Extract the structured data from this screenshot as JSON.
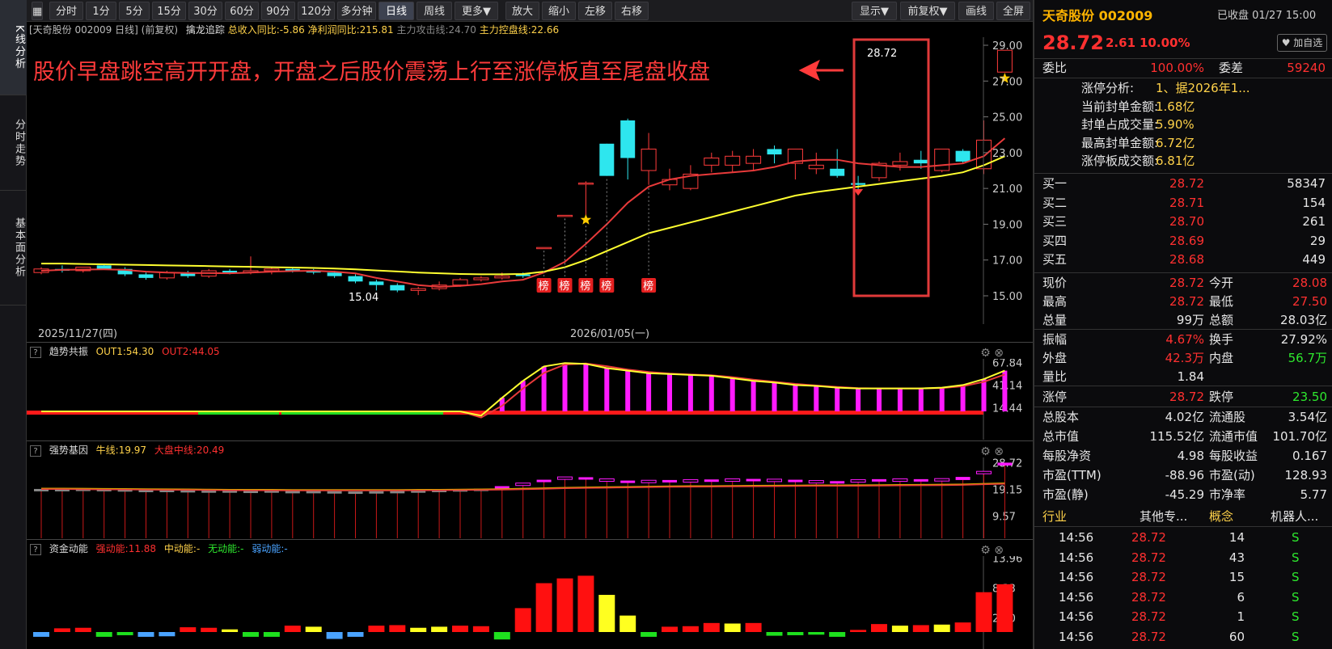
{
  "side_tabs": [
    "K线分析",
    "分时走势",
    "基本面分析"
  ],
  "toolbar": {
    "periods": [
      "分时",
      "1分",
      "5分",
      "15分",
      "30分",
      "60分",
      "90分",
      "120分",
      "多分钟",
      "日线",
      "周线",
      "更多▼"
    ],
    "active_period": "日线",
    "tools": [
      "放大",
      "缩小",
      "左移",
      "右移"
    ],
    "right": [
      "显示▼",
      "前复权▼",
      "画线",
      "全屏"
    ]
  },
  "info_line": {
    "stock": "[天奇股份 002009 日线]",
    "adj": "(前复权)",
    "indicator": "擒龙追踪",
    "revenue_yoy": "总收入同比:-5.86",
    "profit_yoy": "净利润同比:215.81",
    "attack_line": "主力攻击线:24.70",
    "control_line": "主力控盘线:22.66"
  },
  "annotation": "股价早盘跳空高开开盘，开盘之后股价震荡上行至涨停板直至尾盘收盘",
  "main_chart": {
    "price_axis": [
      "29.00",
      "27.00",
      "25.00",
      "23.00",
      "21.00",
      "19.00",
      "17.00",
      "15.00"
    ],
    "last_price_label": "28.72",
    "low_label": "15.04",
    "bang_label": "榜",
    "dates": [
      "2025/11/27(四)",
      "2026/01/05(一)"
    ]
  },
  "panels": {
    "trend": {
      "name": "趋势共振",
      "out1": "OUT1:54.30",
      "out2": "OUT2:44.05",
      "axis": [
        "67.84",
        "41.14",
        "14.44"
      ]
    },
    "gene": {
      "name": "强势基因",
      "bull": "牛线:19.97",
      "mid": "大盘中线:20.49",
      "axis": [
        "28.72",
        "19.15",
        "9.57"
      ]
    },
    "fund": {
      "name": "资金动能",
      "strong": "强动能:11.88",
      "medium": "中动能:-",
      "none": "无动能:-",
      "weak": "弱动能:-",
      "axis": [
        "13.96",
        "8.33",
        "2.70"
      ]
    }
  },
  "chart_data": {
    "type": "bar",
    "title": "天奇股份 002009 日线",
    "ohlc": [
      [
        16.3,
        16.6,
        16.2,
        16.5
      ],
      [
        16.5,
        16.7,
        16.3,
        16.4
      ],
      [
        16.4,
        16.6,
        16.3,
        16.6
      ],
      [
        16.7,
        16.8,
        16.5,
        16.5
      ],
      [
        16.5,
        16.6,
        16.1,
        16.2
      ],
      [
        16.2,
        16.3,
        15.9,
        16.0
      ],
      [
        16.0,
        16.4,
        15.9,
        16.3
      ],
      [
        16.3,
        16.4,
        16.0,
        16.1
      ],
      [
        16.1,
        16.5,
        16.0,
        16.4
      ],
      [
        16.4,
        16.5,
        16.2,
        16.3
      ],
      [
        16.3,
        17.2,
        16.2,
        16.4
      ],
      [
        16.4,
        16.6,
        16.2,
        16.5
      ],
      [
        16.5,
        16.6,
        16.3,
        16.4
      ],
      [
        16.4,
        16.5,
        16.2,
        16.3
      ],
      [
        16.3,
        16.4,
        16.0,
        16.1
      ],
      [
        16.1,
        16.2,
        15.7,
        15.8
      ],
      [
        15.8,
        15.9,
        15.3,
        15.6
      ],
      [
        15.6,
        15.7,
        15.2,
        15.3
      ],
      [
        15.3,
        15.5,
        15.04,
        15.4
      ],
      [
        15.4,
        15.8,
        15.3,
        15.6
      ],
      [
        15.6,
        16.0,
        15.5,
        15.9
      ],
      [
        15.9,
        16.1,
        15.8,
        16.0
      ],
      [
        16.0,
        16.3,
        15.9,
        16.1
      ],
      [
        16.2,
        16.3,
        16.0,
        16.1
      ],
      [
        17.7,
        17.7,
        17.7,
        17.7
      ],
      [
        19.5,
        19.5,
        19.5,
        19.5
      ],
      [
        21.3,
        21.4,
        19.1,
        21.3
      ],
      [
        23.5,
        23.5,
        21.7,
        21.7
      ],
      [
        24.8,
        24.9,
        21.5,
        22.7
      ],
      [
        22.0,
        24.1,
        21.2,
        23.2
      ],
      [
        21.2,
        22.1,
        20.9,
        21.5
      ],
      [
        21.0,
        22.3,
        20.9,
        21.8
      ],
      [
        22.3,
        23.0,
        21.9,
        22.7
      ],
      [
        22.3,
        23.1,
        21.9,
        22.8
      ],
      [
        22.4,
        23.2,
        22.0,
        22.8
      ],
      [
        23.2,
        23.4,
        22.4,
        22.9
      ],
      [
        22.4,
        23.1,
        21.5,
        23.2
      ],
      [
        22.1,
        23.0,
        21.8,
        22.3
      ],
      [
        22.1,
        23.2,
        21.6,
        21.7
      ],
      [
        21.3,
        21.7,
        20.8,
        21.2
      ],
      [
        21.6,
        22.5,
        21.4,
        22.4
      ],
      [
        22.3,
        23.0,
        22.0,
        22.5
      ],
      [
        22.6,
        23.1,
        22.1,
        22.4
      ],
      [
        22.0,
        23.0,
        21.9,
        23.2
      ],
      [
        23.1,
        23.2,
        22.4,
        22.5
      ],
      [
        22.1,
        24.8,
        21.8,
        23.7
      ],
      [
        27.5,
        28.72,
        27.5,
        28.72
      ]
    ],
    "ma_short": [
      16.4,
      16.45,
      16.47,
      16.48,
      16.45,
      16.35,
      16.3,
      16.28,
      16.27,
      16.26,
      16.3,
      16.35,
      16.38,
      16.4,
      16.35,
      16.25,
      16.0,
      15.8,
      15.6,
      15.5,
      15.55,
      15.65,
      15.8,
      15.9,
      16.3,
      16.9,
      17.9,
      19.0,
      20.2,
      21.1,
      21.5,
      21.7,
      21.8,
      21.9,
      22.0,
      22.2,
      22.5,
      22.6,
      22.6,
      22.4,
      22.3,
      22.2,
      22.2,
      22.3,
      22.4,
      22.8,
      23.8
    ],
    "ma_long": [
      16.8,
      16.8,
      16.78,
      16.76,
      16.74,
      16.72,
      16.7,
      16.68,
      16.66,
      16.64,
      16.62,
      16.6,
      16.58,
      16.56,
      16.52,
      16.48,
      16.42,
      16.36,
      16.3,
      16.26,
      16.22,
      16.2,
      16.2,
      16.22,
      16.35,
      16.6,
      17.0,
      17.5,
      18.0,
      18.5,
      18.8,
      19.1,
      19.4,
      19.7,
      20.0,
      20.3,
      20.6,
      20.8,
      20.95,
      21.1,
      21.25,
      21.4,
      21.55,
      21.7,
      21.9,
      22.3,
      22.8
    ],
    "ylim": [
      15,
      29
    ],
    "bang_marks": [
      24,
      25,
      26,
      27,
      29
    ],
    "trend_bars": [
      0,
      0,
      0,
      0,
      0,
      0,
      0,
      0,
      0,
      0,
      0,
      0,
      0,
      0,
      0,
      0,
      0,
      0,
      0,
      0,
      0,
      5,
      26,
      46,
      63,
      67,
      66,
      61,
      58,
      55,
      54,
      53,
      52,
      49,
      46,
      44,
      41,
      40,
      38,
      37,
      37,
      37,
      37,
      38,
      41,
      48,
      58
    ],
    "trend_ylim": [
      10,
      70
    ],
    "gene_bars": [
      [
        19.1,
        19.3
      ],
      [
        19.2,
        19.3
      ],
      [
        19.2,
        19.4
      ],
      [
        19.1,
        19.3
      ],
      [
        19.0,
        19.2
      ],
      [
        18.8,
        19.0
      ],
      [
        18.8,
        19.0
      ],
      [
        18.6,
        18.9
      ],
      [
        18.6,
        18.8
      ],
      [
        18.6,
        18.8
      ],
      [
        18.5,
        18.7
      ],
      [
        18.6,
        18.8
      ],
      [
        18.4,
        18.6
      ],
      [
        18.4,
        18.6
      ],
      [
        18.3,
        18.5
      ],
      [
        18.2,
        18.4
      ],
      [
        18.3,
        18.5
      ],
      [
        18.4,
        18.6
      ],
      [
        18.6,
        18.8
      ],
      [
        18.8,
        19.0
      ],
      [
        19.0,
        19.2
      ],
      [
        19.3,
        19.4
      ],
      [
        20.0,
        20.3
      ],
      [
        20.8,
        21.4
      ],
      [
        22.2,
        22.6
      ],
      [
        23.0,
        23.6
      ],
      [
        22.7,
        23.5
      ],
      [
        22.4,
        22.9
      ],
      [
        21.9,
        22.3
      ],
      [
        22.0,
        22.4
      ],
      [
        22.1,
        22.5
      ],
      [
        22.2,
        22.6
      ],
      [
        22.3,
        22.7
      ],
      [
        22.4,
        22.9
      ],
      [
        22.5,
        22.9
      ],
      [
        22.3,
        22.8
      ],
      [
        22.2,
        22.6
      ],
      [
        21.9,
        22.3
      ],
      [
        21.6,
        22.1
      ],
      [
        22.1,
        22.6
      ],
      [
        22.3,
        22.8
      ],
      [
        22.4,
        22.9
      ],
      [
        22.3,
        22.8
      ],
      [
        22.6,
        23.0
      ],
      [
        22.5,
        23.6
      ],
      [
        25.3,
        25.6
      ],
      [
        27.7,
        28.72
      ]
    ],
    "gene_line": [
      19.5,
      19.5,
      19.45,
      19.4,
      19.35,
      19.3,
      19.25,
      19.2,
      19.15,
      19.1,
      19.05,
      19.05,
      19.0,
      19.0,
      19.0,
      19.0,
      19.0,
      19.0,
      19.05,
      19.1,
      19.15,
      19.2,
      19.3,
      19.45,
      19.6,
      19.8,
      19.9,
      20.0,
      20.1,
      20.2,
      20.3,
      20.35,
      20.4,
      20.45,
      20.5,
      20.55,
      20.6,
      20.65,
      20.65,
      20.7,
      20.75,
      20.8,
      20.85,
      20.9,
      21.0,
      21.2,
      21.4
    ],
    "gene_ylim": [
      8,
      30
    ],
    "fund_bars": [
      0.9,
      0.7,
      0.8,
      0.9,
      0.6,
      0.9,
      0.8,
      0.9,
      0.8,
      0.5,
      0.9,
      0.9,
      1.2,
      1.0,
      1.3,
      0.9,
      1.2,
      1.3,
      0.8,
      1.0,
      1.2,
      1.1,
      1.4,
      4.5,
      9.2,
      10.1,
      10.6,
      7.0,
      3.1,
      0.9,
      1.0,
      1.1,
      1.7,
      1.6,
      1.7,
      0.7,
      0.6,
      0.5,
      0.9,
      0.4,
      1.5,
      1.2,
      1.3,
      1.4,
      1.8,
      7.5,
      9.0
    ],
    "fund_colors": [
      "blue",
      "red",
      "red",
      "green",
      "green",
      "blue",
      "blue",
      "red",
      "red",
      "yellow",
      "green",
      "green",
      "red",
      "yellow",
      "blue",
      "blue",
      "red",
      "red",
      "yellow",
      "yellow",
      "red",
      "red",
      "green",
      "red",
      "red",
      "red",
      "red",
      "yellow",
      "yellow",
      "green",
      "red",
      "red",
      "red",
      "yellow",
      "red",
      "green",
      "green",
      "green",
      "green",
      "red",
      "red",
      "yellow",
      "red",
      "yellow",
      "red",
      "red",
      "red"
    ],
    "fund_ylim": [
      0,
      14
    ]
  },
  "quote": {
    "name": "天奇股份 002009",
    "status": "已收盘 01/27 15:00",
    "price": "28.72",
    "change": "2.61",
    "pct": "10.00%",
    "watch_btn": "加自选",
    "weibi_label": "委比",
    "weibi": "100.00%",
    "weicha_label": "委差",
    "weicha": "59240",
    "limit_analysis": [
      {
        "k": "涨停分析:",
        "v": "1、据2026年1..."
      },
      {
        "k": "当前封单金额:",
        "v": "1.68亿"
      },
      {
        "k": "封单占成交量:",
        "v": "5.90%"
      },
      {
        "k": "最高封单金额:",
        "v": "6.72亿"
      },
      {
        "k": "涨停板成交额:",
        "v": "6.81亿"
      }
    ],
    "bids": [
      {
        "k": "买一",
        "p": "28.72",
        "v": "58347"
      },
      {
        "k": "买二",
        "p": "28.71",
        "v": "154"
      },
      {
        "k": "买三",
        "p": "28.70",
        "v": "261"
      },
      {
        "k": "买四",
        "p": "28.69",
        "v": "29"
      },
      {
        "k": "买五",
        "p": "28.68",
        "v": "449"
      }
    ],
    "stats1": [
      {
        "k1": "现价",
        "v1": "28.72",
        "c1": "red",
        "k2": "今开",
        "v2": "28.08",
        "c2": "red"
      },
      {
        "k1": "最高",
        "v1": "28.72",
        "c1": "red",
        "k2": "最低",
        "v2": "27.50",
        "c2": "red"
      },
      {
        "k1": "总量",
        "v1": "99万",
        "c1": "white",
        "k2": "总额",
        "v2": "28.03亿",
        "c2": "white"
      }
    ],
    "stats2": [
      {
        "k1": "振幅",
        "v1": "4.67%",
        "c1": "red",
        "k2": "换手",
        "v2": "27.92%",
        "c2": "white"
      },
      {
        "k1": "外盘",
        "v1": "42.3万",
        "c1": "red",
        "k2": "内盘",
        "v2": "56.7万",
        "c2": "green"
      },
      {
        "k1": "量比",
        "v1": "1.84",
        "c1": "white",
        "k2": "",
        "v2": "",
        "c2": "white"
      }
    ],
    "limit_row": {
      "k1": "涨停",
      "v1": "28.72",
      "k2": "跌停",
      "v2": "23.50"
    },
    "fundamentals": [
      {
        "k1": "总股本",
        "v1": "4.02亿",
        "k2": "流通股",
        "v2": "3.54亿"
      },
      {
        "k1": "总市值",
        "v1": "115.52亿",
        "k2": "流通市值",
        "v2": "101.70亿"
      },
      {
        "k1": "每股净资",
        "v1": "4.98",
        "k2": "每股收益",
        "v2": "0.167"
      },
      {
        "k1": "市盈(TTM)",
        "v1": "-88.96",
        "k2": "市盈(动)",
        "v2": "128.93"
      },
      {
        "k1": "市盈(静)",
        "v1": "-45.29",
        "k2": "市净率",
        "v2": "5.77"
      }
    ],
    "industry_row": {
      "k1": "行业",
      "v1": "其他专...",
      "k2": "概念",
      "v2": "机器人..."
    },
    "ticks": [
      {
        "t": "14:56",
        "p": "28.72",
        "v": "14",
        "s": "S"
      },
      {
        "t": "14:56",
        "p": "28.72",
        "v": "43",
        "s": "S"
      },
      {
        "t": "14:56",
        "p": "28.72",
        "v": "15",
        "s": "S"
      },
      {
        "t": "14:56",
        "p": "28.72",
        "v": "6",
        "s": "S"
      },
      {
        "t": "14:56",
        "p": "28.72",
        "v": "1",
        "s": "S"
      },
      {
        "t": "14:56",
        "p": "28.72",
        "v": "60",
        "s": "S"
      }
    ]
  }
}
